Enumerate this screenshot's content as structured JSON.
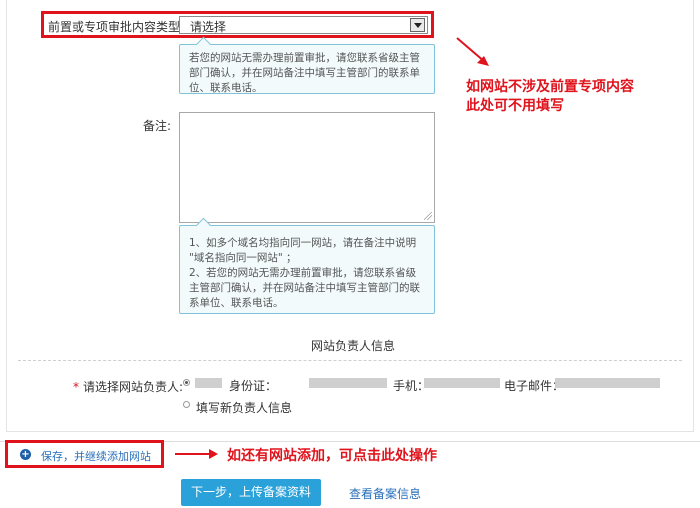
{
  "form": {
    "type_label": "前置或专项审批内容类型:",
    "type_select_value": "请选择",
    "tip1_text": "若您的网站无需办理前置审批，请您联系省级主管部门确认，并在网站备注中填写主管部门的联系单位、联系电话。",
    "remark_label": "备注:",
    "tip2_line1": "1、如多个域名均指向同一网站，请在备注中说明 \"域名指向同一网站\" ；",
    "tip2_line2": "2、若您的网站无需办理前置审批，请您联系省级主管部门确认，并在网站备注中填写主管部门的联系单位、联系电话。"
  },
  "owner": {
    "section_title": "网站负责人信息",
    "required_mark": "*",
    "select_label": "请选择网站负责人:",
    "id_label": "身份证：",
    "phone_label": "手机：",
    "email_label": "电子邮件：",
    "new_owner_label": "填写新负责人信息"
  },
  "actions": {
    "save_add_label": "保存，并继续添加网站",
    "next_label": "下一步，上传备案资料",
    "view_label": "查看备案信息"
  },
  "annotations": {
    "right_line1": "如网站不涉及前置专项内容",
    "right_line2": "此处可不用填写",
    "bottom": "如还有网站添加，可点击此处操作"
  },
  "colors": {
    "highlight": "#e0121b",
    "primary_button": "#2aa2d9",
    "link": "#2a6fb9",
    "tip_border": "#7fc4d6"
  }
}
